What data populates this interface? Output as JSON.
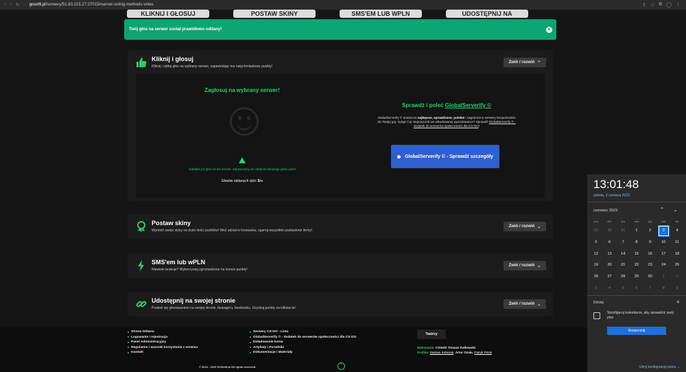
{
  "browser": {
    "url_host": "gosetti.pl",
    "url_path": "/serwery/51.83.215.27:27015#server-voting-methods-votes"
  },
  "top_buttons": [
    "KLIKNIJ I GŁOSUJ",
    "POSTAW SKINY",
    "SMS'EM LUB WPLN",
    "UDOSTĘPNIJ NA"
  ],
  "alert": {
    "message": "Twój głos na serwer został prawidłowo oddany!"
  },
  "cards": [
    {
      "title": "Kliknij i głosuj",
      "subtitle": "Kliknij i oddaj głos na wybrany serwer, zapewniając mu natychmiastowe punkty!",
      "toggle": "Zwiń / rozwiń",
      "icon": "thumbs-up-icon"
    },
    {
      "title": "Postaw skiny",
      "subtitle": "Wymień swoje skiny na duże ilości punktów! Weź udział w losowaniu, zgarnij wszystkie postawione itemy!",
      "toggle": "Zwiń / rozwiń",
      "icon": "award-icon"
    },
    {
      "title": "SMS'em lub wPLN",
      "subtitle": "Niewiele brakuje? Wykorzystaj zgromadzone na koncie punkty!",
      "toggle": "Zwiń / rozwiń",
      "icon": "bolt-icon"
    },
    {
      "title": "Udostępnij na swojej stronie",
      "subtitle": "Podziel się głosowaniem na swojej stronie, fanpage'u, facebooku. Uzyskaj punkty za kliknięcia!",
      "toggle": "Zwiń / rozwiń",
      "icon": "link-icon"
    }
  ],
  "vote": {
    "title": "Zagłosuj na wybrany serwer!",
    "warning": "Oddałeś już głos na ten serwer. Zapraszamy do oddania kolejnego głosu jutro!",
    "votes_today_label": "Głosów oddanych dziś:",
    "votes_today_value": "5/∞"
  },
  "globalserverify": {
    "title_prefix": "Sprawdź i poleć",
    "title_link": "GlobalServerify ©",
    "desc_1": "GlobalServerify © dostarcza",
    "desc_bold": "najlepsze, sprawdzone, polskie",
    "desc_2": "i zagraniczne serwery bezpośrednio do Twojej gry. Irytuje Cię nieporęczek we wbudowanej wyszukiwarce? Sprawdź",
    "desc_link": "GlobalServerify © - dodatek do serwerów społeczności dla CS:GO",
    "desc_end": "!",
    "button": "GlobalServerify © - Sprawdź szczegóły"
  },
  "footer": {
    "col1": [
      "Strona Główna",
      "Logowanie i rejestracja",
      "Panel Administracyjny",
      "Regulamin i warunki korzystania z serwisu",
      "Kontakt"
    ],
    "col2": [
      "Serwery CS:GO - Lista",
      "GlobalServerify © - dodatek do serwerów społeczności dla CS:GO",
      "Doładowanie konta",
      "Artykuły i Poradniki",
      "Dokumentacje i Materiały"
    ],
    "creators_button": "Twórcy",
    "made_by_label": "Wykonanie:",
    "made_by": "CSSetti Tomasz Kalkowski",
    "graphics_label": "Grafika:",
    "graphics": [
      "Damian Kubiciak",
      "Artur Ozuła",
      "Patryk Polak"
    ],
    "copyright": "© 2016 - 2023 GOSetti.pl All rights reserved."
  },
  "calendar": {
    "time": "13:01:48",
    "date": "sobota, 3 czerwca 2023",
    "month": "czerwiec 2023",
    "weekdays": [
      "pon",
      "wto",
      "śro",
      "czw",
      "pią",
      "sob",
      "nie"
    ],
    "days": [
      "29",
      "30",
      "31",
      "1",
      "2",
      "3",
      "4",
      "5",
      "6",
      "7",
      "8",
      "9",
      "10",
      "11",
      "12",
      "13",
      "14",
      "15",
      "16",
      "17",
      "18",
      "19",
      "20",
      "21",
      "22",
      "23",
      "24",
      "25",
      "26",
      "27",
      "28",
      "29",
      "30",
      "1",
      "2",
      "3",
      "4",
      "5",
      "6",
      "7",
      "8",
      "9"
    ],
    "today_label": "Dzisiaj",
    "event_text": "Skonfiguruj kalendarze, aby sprawdzić swój plan",
    "start_button": "Rozpocznij",
    "hide_link": "Ukryj konfigurację planu"
  }
}
